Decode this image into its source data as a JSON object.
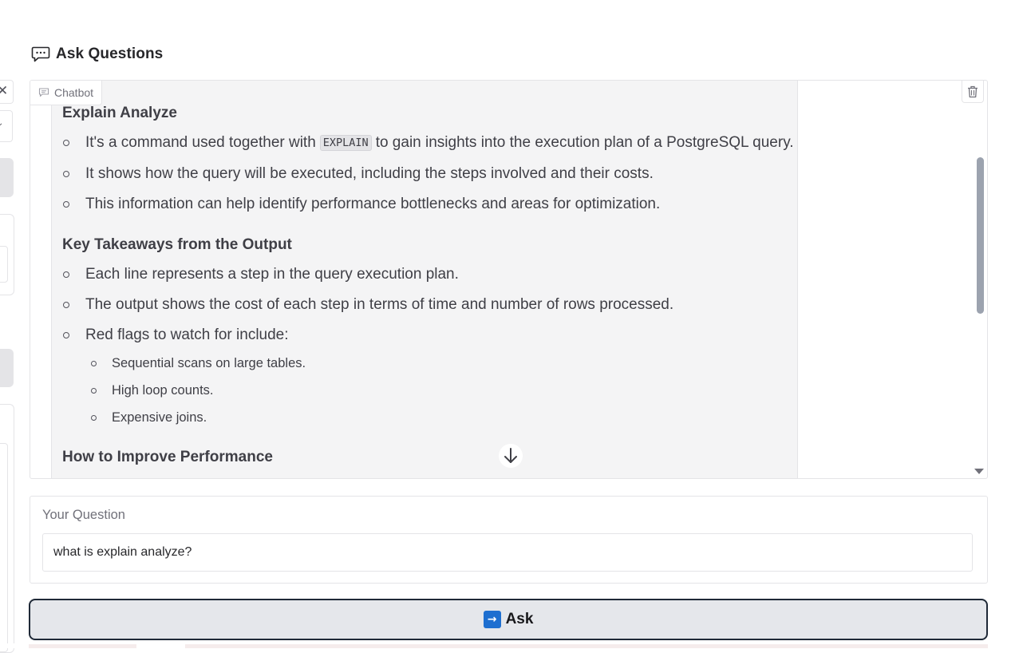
{
  "sidebar": {
    "close_glyph": "✕",
    "chevron_glyph": "⌄"
  },
  "header": {
    "title": "Ask Questions",
    "icon": "chat-bubble-icon"
  },
  "chatbot": {
    "label": "Chatbot",
    "label_icon": "chat-icon",
    "clear_icon": "trash-icon",
    "scroll_icon": "arrow-down-icon",
    "message": {
      "sections": [
        {
          "heading": "Explain Analyze",
          "items": [
            {
              "pre": "It's a command used together with",
              "code": "EXPLAIN",
              "post": "to gain insights into the execution plan of a PostgreSQL query."
            },
            {
              "text": "It shows how the query will be executed, including the steps involved and their costs."
            },
            {
              "text": "This information can help identify performance bottlenecks and areas for optimization."
            }
          ]
        },
        {
          "heading": "Key Takeaways from the Output",
          "items": [
            {
              "text": "Each line represents a step in the query execution plan."
            },
            {
              "text": "The output shows the cost of each step in terms of time and number of rows processed."
            },
            {
              "text": "Red flags to watch for include:",
              "subitems": [
                "Sequential scans on large tables.",
                "High loop counts.",
                "Expensive joins."
              ]
            }
          ]
        },
        {
          "heading": "How to Improve Performance"
        }
      ]
    }
  },
  "question": {
    "label": "Your Question",
    "value": "what is explain analyze?"
  },
  "ask_button": {
    "icon_glyph": "→",
    "icon": "arrow-right-icon",
    "label": "Ask"
  },
  "colors": {
    "accent": "#1e6fd0",
    "button_bg": "#e5e7eb",
    "bubble_bg": "#f4f4f5"
  }
}
